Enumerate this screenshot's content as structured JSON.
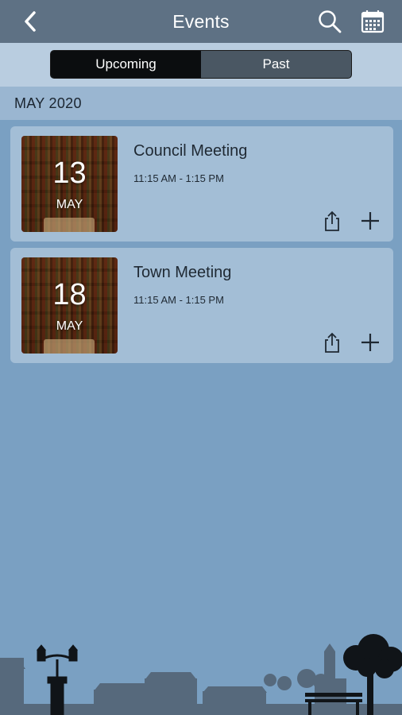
{
  "header": {
    "title": "Events",
    "back_icon": "chevron-left-icon",
    "search_icon": "search-icon",
    "calendar_icon": "calendar-icon"
  },
  "tabs": [
    {
      "label": "Upcoming",
      "active": true
    },
    {
      "label": "Past",
      "active": false
    }
  ],
  "month_header": "MAY 2020",
  "events": [
    {
      "day": "13",
      "month": "MAY",
      "title": "Council Meeting",
      "time": "11:15 AM - 1:15 PM"
    },
    {
      "day": "18",
      "month": "MAY",
      "title": "Town Meeting",
      "time": "11:15 AM - 1:15 PM"
    }
  ],
  "colors": {
    "background": "#7aa0c2",
    "topbar": "#5e7184",
    "card": "#a3bed6",
    "segment_active": "#0b0d0f",
    "skyline": "#53677a"
  }
}
